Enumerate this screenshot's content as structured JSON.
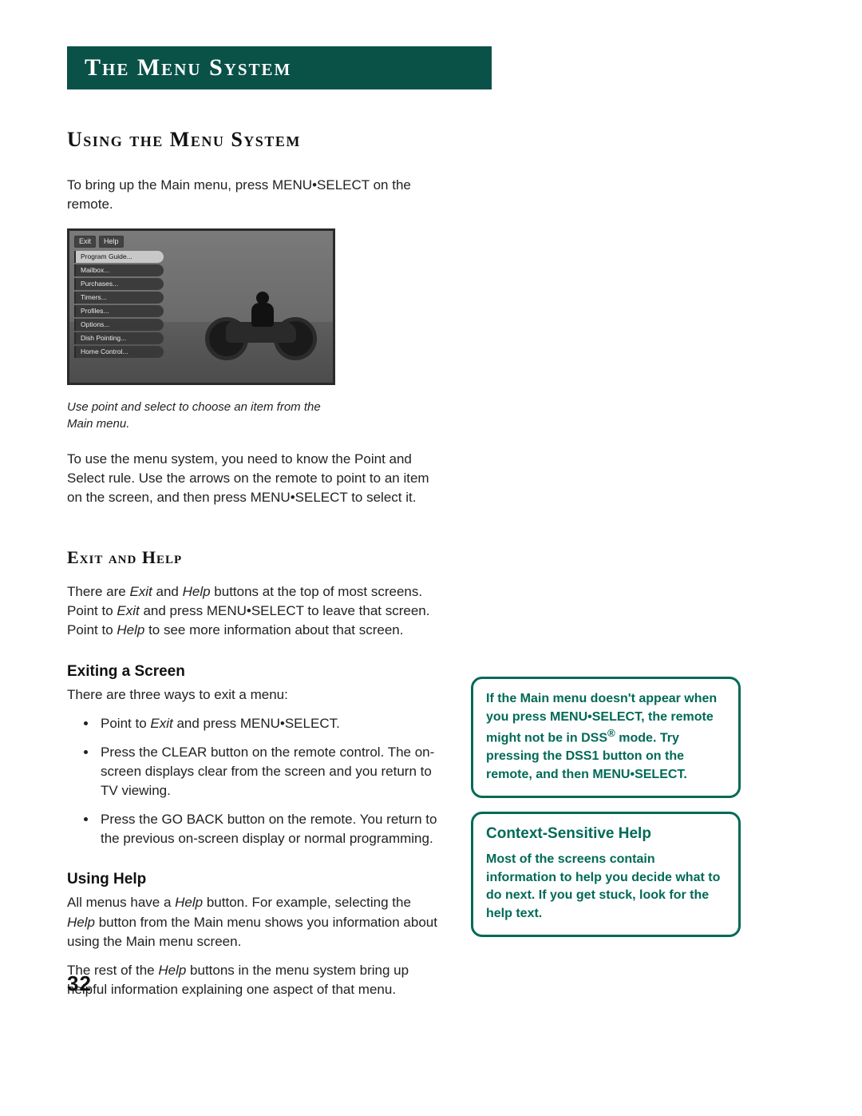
{
  "banner": {
    "title": "The Menu System"
  },
  "section": {
    "heading": "Using the Menu System",
    "p1a": "To bring up the Main menu, press MENU",
    "p1b": "SELECT on the remote."
  },
  "figure": {
    "osd": {
      "top": {
        "exit": "Exit",
        "help": "Help"
      },
      "items": [
        "Program Guide...",
        "Mailbox...",
        "Purchases...",
        "Timers...",
        "Profiles...",
        "Options...",
        "Dish Pointing...",
        "Home Control..."
      ]
    },
    "caption": "Use point and select to choose an item from the Main menu."
  },
  "p2a": "To use the menu system, you need to know the Point and Select rule. Use the arrows on the remote to point to an item on the screen, and then press MENU",
  "p2b": "SELECT to select it.",
  "exit_help": {
    "heading": "Exit and Help",
    "p_a": "There are ",
    "p_b": "Exit",
    "p_c": " and ",
    "p_d": "Help",
    "p_e": " buttons at the top of most screens. Point to ",
    "p_f": "Exit",
    "p_g": " and press MENU",
    "p_h": "SELECT to leave that screen. Point to ",
    "p_i": "Help",
    "p_j": " to see more information about that screen."
  },
  "exiting": {
    "heading": "Exiting a Screen",
    "intro": "There are three ways to exit a menu:",
    "b1a": "Point to ",
    "b1b": "Exit",
    "b1c": " and press MENU",
    "b1d": "SELECT.",
    "b2": "Press the CLEAR button on the remote control. The on-screen displays clear from the screen and you return to TV viewing.",
    "b3": "Press the GO BACK button on the remote. You return to the previous on-screen display or normal programming."
  },
  "using_help": {
    "heading": "Using Help",
    "p1a": "All menus have a ",
    "p1b": "Help",
    "p1c": " button. For example, selecting the ",
    "p1d": "Help",
    "p1e": " button from the Main menu shows you information about using the Main menu screen.",
    "p2a": "The rest of the ",
    "p2b": "Help",
    "p2c": " buttons in the menu system bring up helpful information explaining one aspect of that menu."
  },
  "callout1": {
    "l1": "If the Main menu doesn't appear when you press MENU",
    "l2": "SELECT, the remote might not be in DSS",
    "l3": " mode. Try pressing the DSS1 button on the remote, and then MENU",
    "l4": "SELECT."
  },
  "callout2": {
    "title": "Context-Sensitive Help",
    "body": "Most of the screens contain information to help you decide what to do next. If you get stuck, look for the help text."
  },
  "page_number": "32",
  "glyphs": {
    "bullet": "•",
    "reg": "®"
  }
}
